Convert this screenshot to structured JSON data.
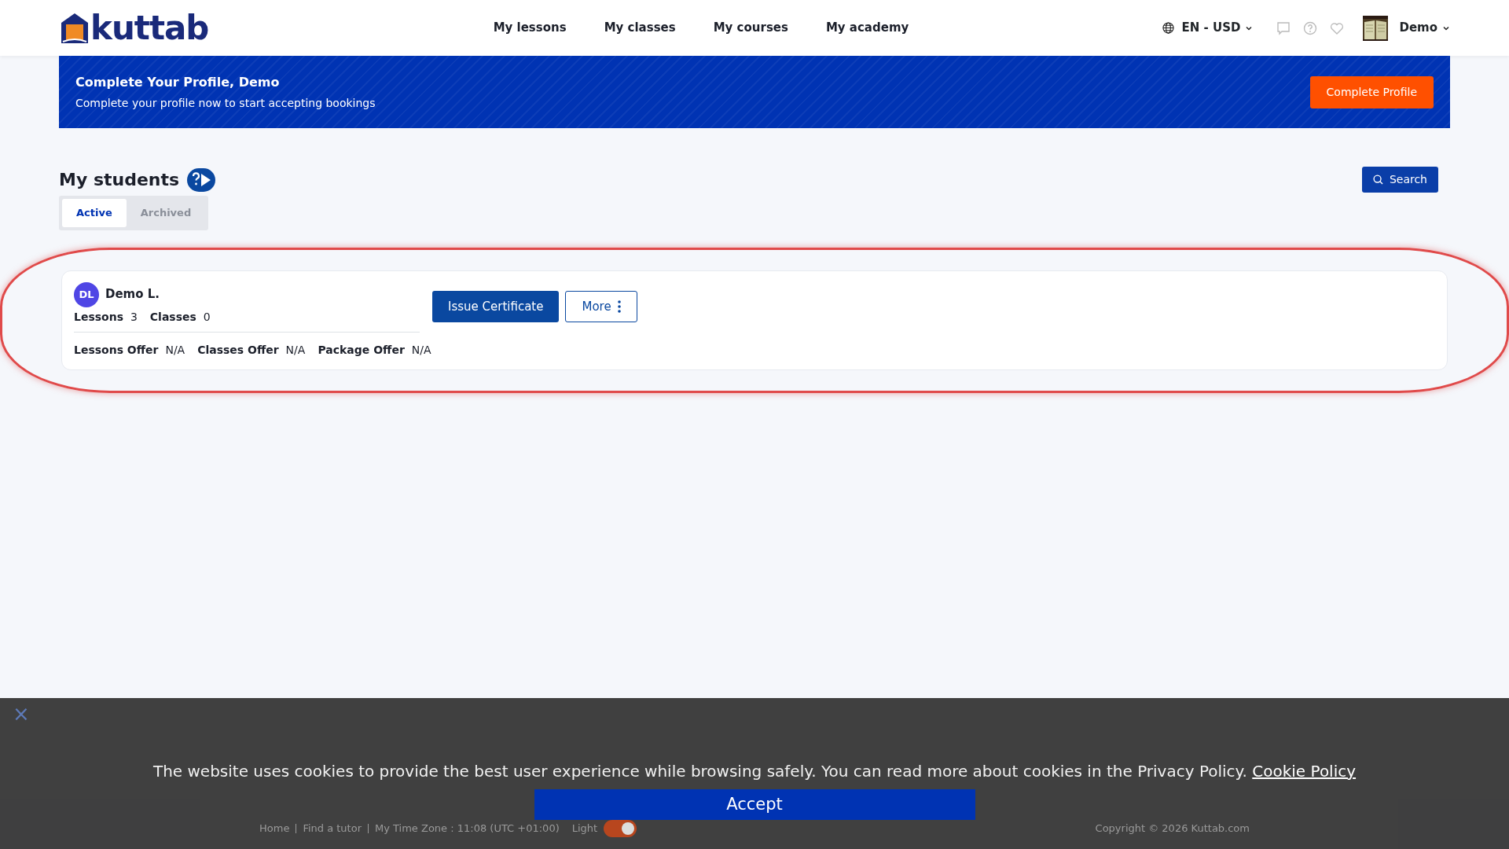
{
  "header": {
    "logo": "kuttab",
    "nav": [
      {
        "label": "My lessons"
      },
      {
        "label": "My classes"
      },
      {
        "label": "My courses"
      },
      {
        "label": "My academy"
      }
    ],
    "locale": "EN - USD",
    "user": "Demo"
  },
  "banner": {
    "title": "Complete Your Profile, Demo",
    "text": "Complete your profile now to start accepting bookings",
    "button": "Complete Profile"
  },
  "page": {
    "title": "My students",
    "search": "Search",
    "tabs": [
      {
        "label": "Active",
        "selected": true
      },
      {
        "label": "Archived",
        "selected": false
      }
    ]
  },
  "students": [
    {
      "initials": "DL",
      "name": "Demo L.",
      "stats": [
        {
          "label": "Lessons",
          "value": "3"
        },
        {
          "label": "Classes",
          "value": "0"
        }
      ],
      "offers": [
        {
          "label": "Lessons Offer",
          "value": "N/A"
        },
        {
          "label": "Classes Offer",
          "value": "N/A"
        },
        {
          "label": "Package Offer",
          "value": "N/A"
        }
      ],
      "primary_action": "Issue Certificate",
      "more_action": "More"
    }
  ],
  "footer": {
    "links": [
      "Home",
      "Find a tutor",
      "My Time Zone : 11:08 (UTC +01:00)"
    ],
    "theme": "Light",
    "toggle_on": true,
    "copyright": "Copyright © 2026 Kuttab.com"
  },
  "cookie": {
    "close": "×",
    "text": "The website uses cookies to provide the best user experience while browsing safely. You can read more about cookies in the Privacy Policy.",
    "link": "Cookie Policy",
    "button": "Accept"
  }
}
